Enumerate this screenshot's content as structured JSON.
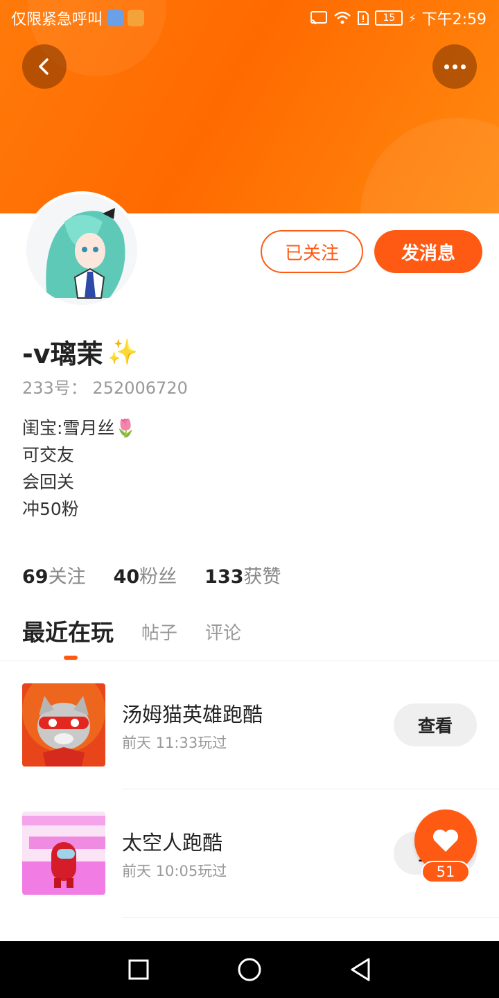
{
  "status_bar": {
    "emergency_text": "仅限紧急呼叫",
    "battery": "15",
    "time": "下午2:59"
  },
  "header": {
    "back_icon": "chevron-left-icon",
    "more_icon": "more-horizontal-icon"
  },
  "profile": {
    "follow_state_label": "已关注",
    "message_label": "发消息",
    "name": "-v璃茉",
    "name_emoji": "✨",
    "user_id": "233号： 252006720",
    "bio_lines": [
      "闺宝:雪月丝",
      "可交友",
      "会回关",
      "冲50粉"
    ],
    "bio_emoji": "🌷"
  },
  "stats": [
    {
      "value": "69",
      "label": "关注"
    },
    {
      "value": "40",
      "label": "粉丝"
    },
    {
      "value": "133",
      "label": "获赞"
    }
  ],
  "tabs": [
    {
      "label": "最近在玩",
      "active": true
    },
    {
      "label": "帖子",
      "active": false
    },
    {
      "label": "评论",
      "active": false
    }
  ],
  "games": [
    {
      "title": "汤姆猫英雄跑酷",
      "played": "前天 11:33玩过",
      "action": "查看"
    },
    {
      "title": "太空人跑酷",
      "played": "前天 10:05玩过",
      "action": "查看"
    }
  ],
  "like_button": {
    "count": "51",
    "icon": "heart-icon"
  },
  "colors": {
    "accent": "#ff5a14",
    "header": "#ff7a0a"
  }
}
